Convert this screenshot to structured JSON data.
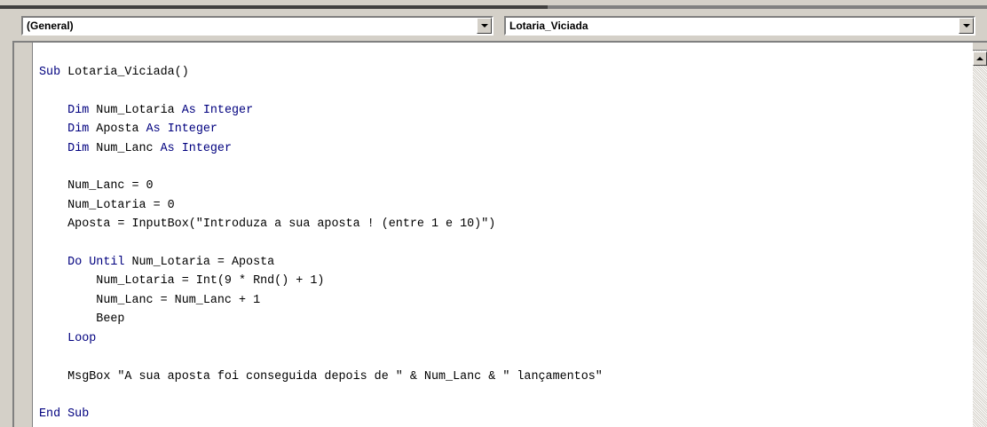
{
  "object_dropdown": {
    "selected": "(General)"
  },
  "procedure_dropdown": {
    "selected": "Lotaria_Viciada"
  },
  "code_lines": [
    [
      {
        "t": "Sub",
        "k": true
      },
      {
        "t": " Lotaria_Viciada()"
      }
    ],
    [],
    [
      {
        "t": "    "
      },
      {
        "t": "Dim",
        "k": true
      },
      {
        "t": " Num_Lotaria "
      },
      {
        "t": "As",
        "k": true
      },
      {
        "t": " "
      },
      {
        "t": "Integer",
        "k": true
      }
    ],
    [
      {
        "t": "    "
      },
      {
        "t": "Dim",
        "k": true
      },
      {
        "t": " Aposta "
      },
      {
        "t": "As",
        "k": true
      },
      {
        "t": " "
      },
      {
        "t": "Integer",
        "k": true
      }
    ],
    [
      {
        "t": "    "
      },
      {
        "t": "Dim",
        "k": true
      },
      {
        "t": " Num_Lanc "
      },
      {
        "t": "As",
        "k": true
      },
      {
        "t": " "
      },
      {
        "t": "Integer",
        "k": true
      }
    ],
    [],
    [
      {
        "t": "    Num_Lanc = 0"
      }
    ],
    [
      {
        "t": "    Num_Lotaria = 0"
      }
    ],
    [
      {
        "t": "    Aposta = InputBox(\"Introduza a sua aposta ! (entre 1 e 10)\")"
      }
    ],
    [],
    [
      {
        "t": "    "
      },
      {
        "t": "Do Until",
        "k": true
      },
      {
        "t": " Num_Lotaria = Aposta"
      }
    ],
    [
      {
        "t": "        Num_Lotaria = Int(9 * Rnd() + 1)"
      }
    ],
    [
      {
        "t": "        Num_Lanc = Num_Lanc + 1"
      }
    ],
    [
      {
        "t": "        Beep"
      }
    ],
    [
      {
        "t": "    "
      },
      {
        "t": "Loop",
        "k": true
      }
    ],
    [],
    [
      {
        "t": "    MsgBox \"A sua aposta foi conseguida depois de \" & Num_Lanc & \" lançamentos\""
      }
    ],
    [],
    [
      {
        "t": "End Sub",
        "k": true
      }
    ]
  ],
  "colors": {
    "keyword": "#00007f",
    "text": "#000000",
    "chrome": "#d4d0c8"
  }
}
